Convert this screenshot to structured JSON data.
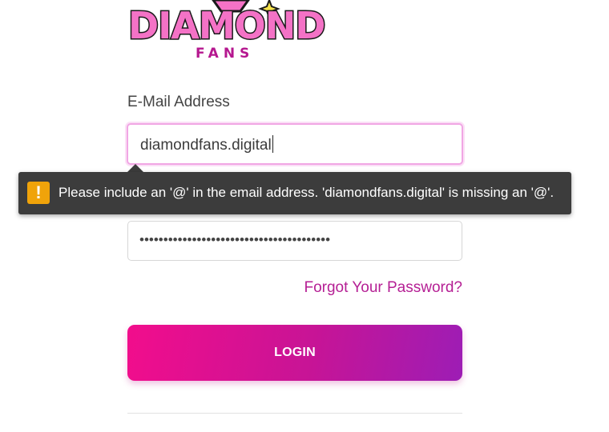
{
  "logo": {
    "name": "DIAMOND",
    "sub": "FANS",
    "colors": {
      "pink": "#f472c6",
      "outline": "#1a1a1a",
      "sub": "#b5178f",
      "star": "#f5e24a"
    }
  },
  "form": {
    "email_label": "E-Mail Address",
    "email_value": "diamondfans.digital",
    "password_mask": "••••••••••••••••••••••••••••••••••••••••",
    "forgot_link": "Forgot Your Password?",
    "login_label": "LOGIN"
  },
  "tooltip": {
    "icon": "warning-icon",
    "message": "Please include an '@' in the email address. 'diamondfans.digital' is missing an '@'."
  },
  "colors": {
    "accent": "#b51f94",
    "button_start": "#f20d8c",
    "button_end": "#9d1db5",
    "tooltip_bg": "#3c3c3c",
    "warning": "#f0a30a"
  }
}
